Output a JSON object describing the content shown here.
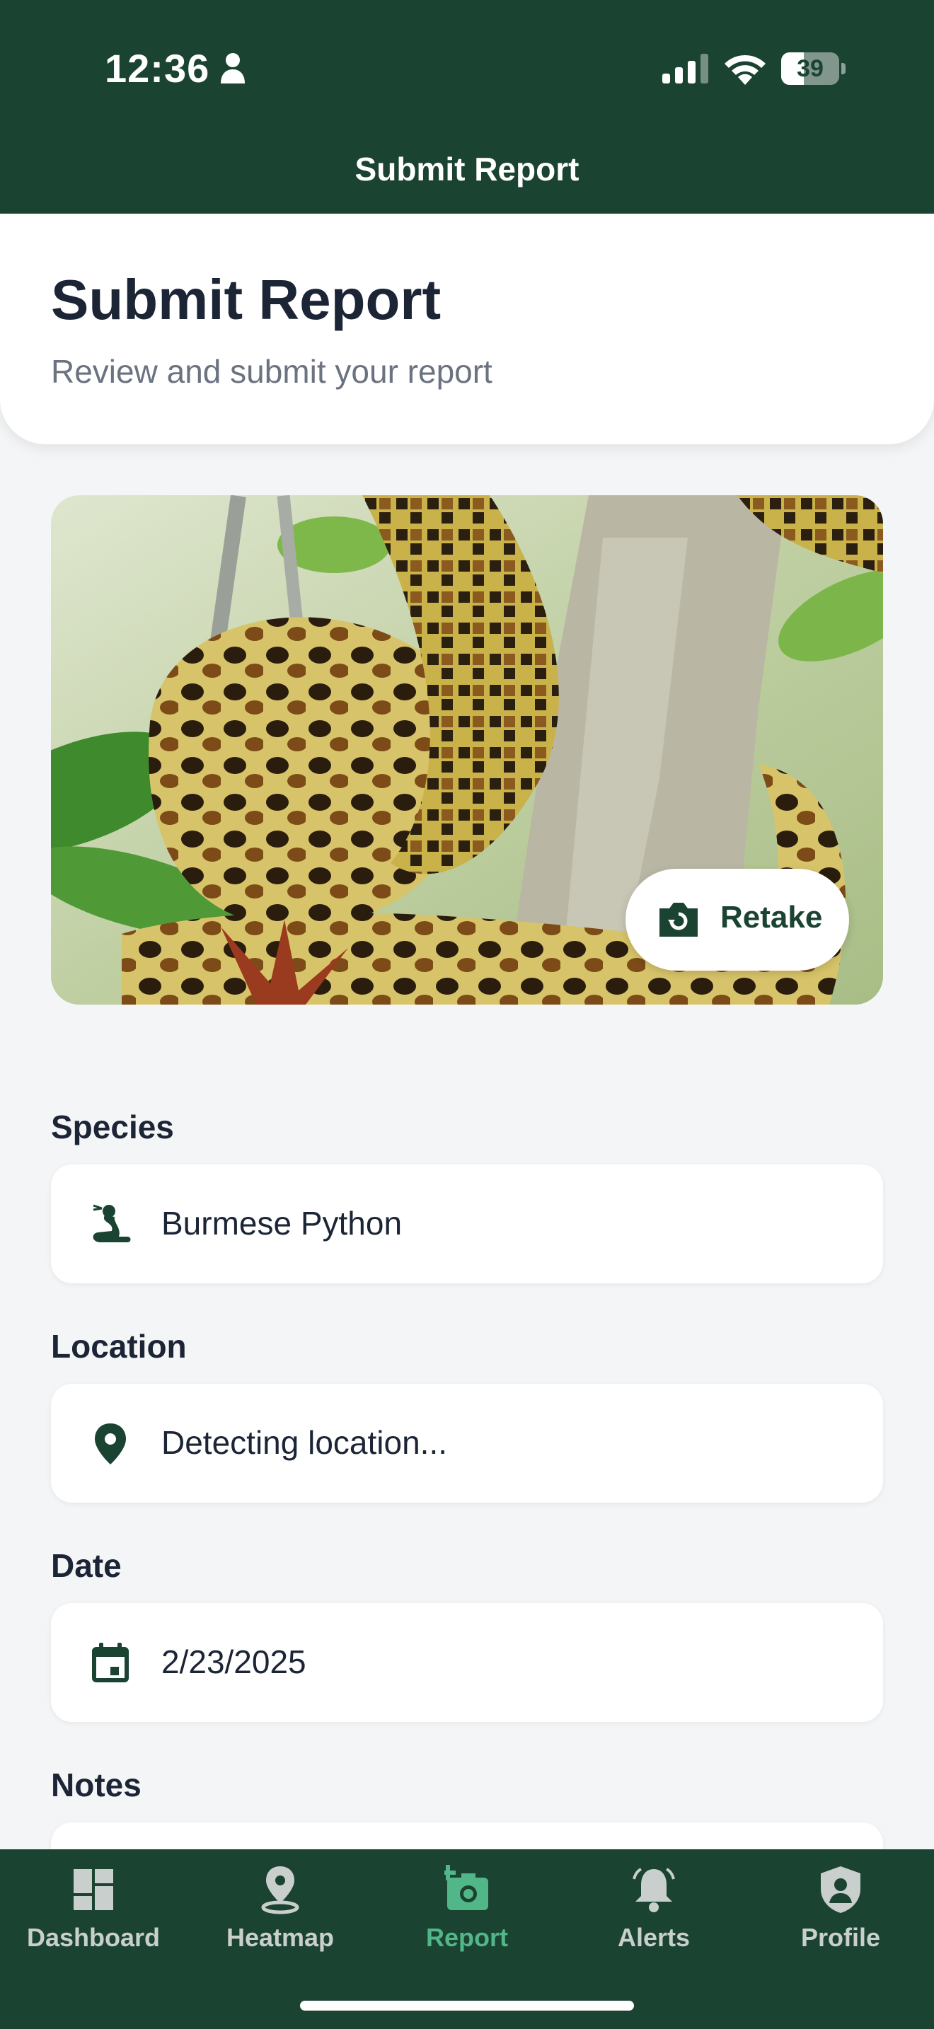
{
  "status_bar": {
    "time": "12:36",
    "battery": "39",
    "battery_level": 0.39
  },
  "nav": {
    "title": "Submit Report"
  },
  "header": {
    "title": "Submit Report",
    "subtitle": "Review and submit your report"
  },
  "photo": {
    "retake_label": "Retake"
  },
  "form": {
    "species": {
      "label": "Species",
      "value": "Burmese Python",
      "icon": "snake-icon"
    },
    "location": {
      "label": "Location",
      "value": "Detecting location...",
      "icon": "map-pin-icon"
    },
    "date": {
      "label": "Date",
      "value": "2/23/2025",
      "icon": "calendar-icon"
    },
    "notes": {
      "label": "Notes",
      "value": ""
    }
  },
  "tabs": [
    {
      "label": "Dashboard",
      "icon": "dashboard-icon",
      "active": false
    },
    {
      "label": "Heatmap",
      "icon": "map-pin-icon",
      "active": false
    },
    {
      "label": "Report",
      "icon": "add-photo-icon",
      "active": true
    },
    {
      "label": "Alerts",
      "icon": "bell-icon",
      "active": false
    },
    {
      "label": "Profile",
      "icon": "shield-user-icon",
      "active": false
    }
  ],
  "colors": {
    "brand_dark": "#1b4332",
    "accent": "#52b788",
    "text_primary": "#1c2536",
    "text_secondary": "#6b7280",
    "background": "#f4f5f6"
  }
}
